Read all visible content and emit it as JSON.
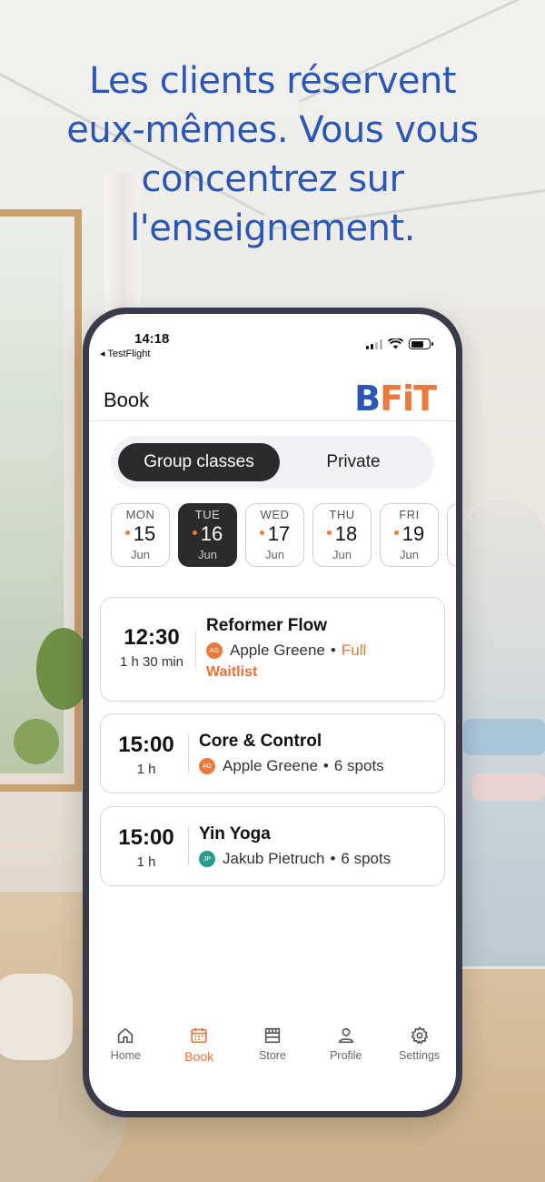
{
  "headline": {
    "line1": "Les clients réservent",
    "line2": "eux-mêmes. Vous vous",
    "line3": "concentrez sur",
    "line4": "l'enseignement."
  },
  "status_bar": {
    "time": "14:18",
    "back_app": "◂ TestFlight"
  },
  "header": {
    "title": "Book",
    "logo_b": "B",
    "logo_fit": "FiT"
  },
  "segmented": {
    "group": "Group classes",
    "private": "Private",
    "selected": "Group classes"
  },
  "days": [
    {
      "dow": "MON",
      "num": "15",
      "mon": "Jun",
      "selected": false
    },
    {
      "dow": "TUE",
      "num": "16",
      "mon": "Jun",
      "selected": true
    },
    {
      "dow": "WED",
      "num": "17",
      "mon": "Jun",
      "selected": false
    },
    {
      "dow": "THU",
      "num": "18",
      "mon": "Jun",
      "selected": false
    },
    {
      "dow": "FRI",
      "num": "19",
      "mon": "Jun",
      "selected": false
    }
  ],
  "classes": [
    {
      "time": "12:30",
      "duration": "1 h 30 min",
      "name": "Reformer Flow",
      "avatar": "AG",
      "instructor": "Apple Greene",
      "spots": "Full",
      "extra": "Waitlist"
    },
    {
      "time": "15:00",
      "duration": "1 h",
      "name": "Core & Control",
      "avatar": "AG",
      "instructor": "Apple Greene",
      "spots": "6 spots"
    },
    {
      "time": "15:00",
      "duration": "1 h",
      "name": "Yin Yoga",
      "avatar": "JP",
      "instructor": "Jakub Pietruch",
      "spots": "6 spots"
    }
  ],
  "tabbar": {
    "home": "Home",
    "book": "Book",
    "store": "Store",
    "profile": "Profile",
    "settings": "Settings",
    "active": "Book"
  },
  "colors": {
    "brand_blue": "#2a56b5",
    "accent_orange": "#ea7a3c",
    "dark": "#2b2b2e"
  }
}
